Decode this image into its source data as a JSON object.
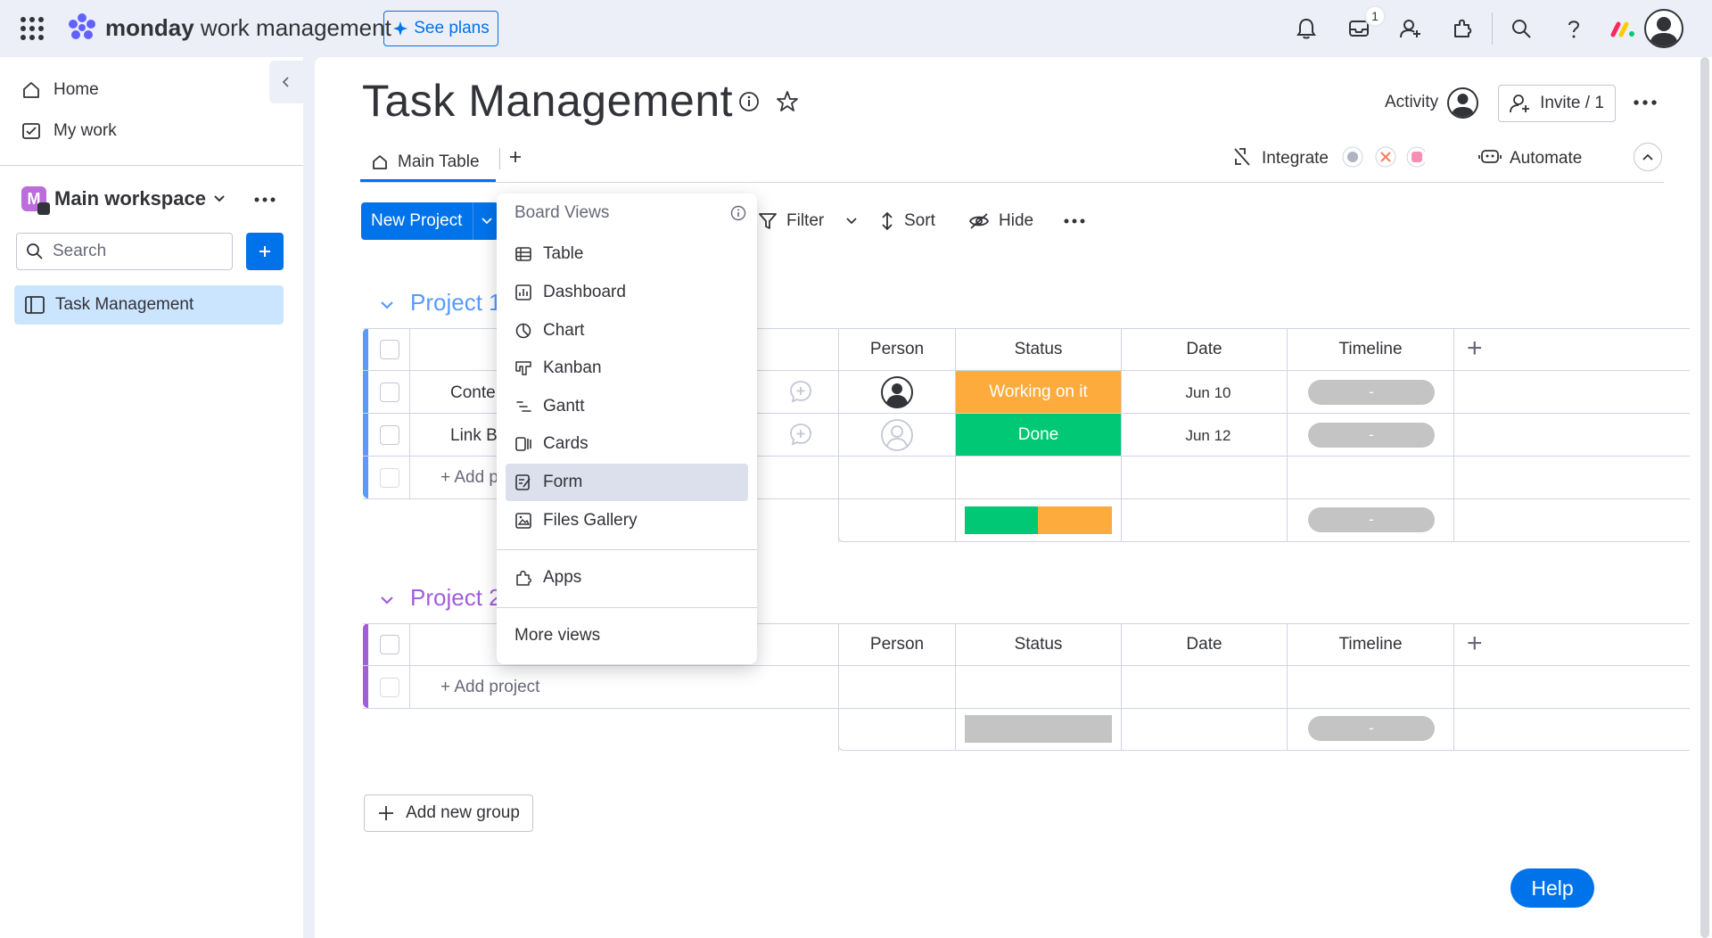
{
  "topbar": {
    "brand_bold": "monday",
    "brand_rest": " work management",
    "see_plans": "See plans",
    "inbox_badge": "1",
    "icons": [
      "apps-grid-icon",
      "bell-icon",
      "inbox-icon",
      "invite-members-icon",
      "marketplace-icon",
      "search-icon",
      "help-icon"
    ]
  },
  "sidebar": {
    "home": "Home",
    "my_work": "My work",
    "workspace_initial": "M",
    "workspace_name": "Main workspace",
    "search_placeholder": "Search",
    "board": "Task Management"
  },
  "board": {
    "title": "Task Management",
    "activity": "Activity",
    "invite": "Invite / 1",
    "tab_main": "Main Table",
    "integrate": "Integrate",
    "automate": "Automate",
    "new_project": "New Project",
    "filter": "Filter",
    "sort": "Sort",
    "hide": "Hide"
  },
  "columns": {
    "person": "Person",
    "status": "Status",
    "date": "Date",
    "timeline": "Timeline"
  },
  "groups": [
    {
      "title": "Project 1",
      "color": "#579bfc",
      "rows": [
        {
          "name": "Conte",
          "status": "Working on it",
          "status_color": "#fdab3d",
          "date": "Jun 10",
          "timeline": "-"
        },
        {
          "name": "Link B",
          "status": "Done",
          "status_color": "#00c875",
          "date": "Jun 12",
          "timeline": "-"
        }
      ],
      "add_row": "+ Add p",
      "summary_timeline": "-"
    },
    {
      "title": "Project 2",
      "color": "#a25ddc",
      "rows": [],
      "add_row": "+ Add project",
      "summary_timeline": "-"
    }
  ],
  "add_group": "Add new group",
  "help": "Help",
  "dropdown": {
    "title": "Board Views",
    "items": [
      {
        "label": "Table",
        "icon": "table-icon"
      },
      {
        "label": "Dashboard",
        "icon": "dashboard-icon"
      },
      {
        "label": "Chart",
        "icon": "chart-icon"
      },
      {
        "label": "Kanban",
        "icon": "kanban-icon"
      },
      {
        "label": "Gantt",
        "icon": "gantt-icon"
      },
      {
        "label": "Cards",
        "icon": "cards-icon"
      },
      {
        "label": "Form",
        "icon": "form-icon"
      },
      {
        "label": "Files Gallery",
        "icon": "files-gallery-icon"
      }
    ],
    "apps": "Apps",
    "more": "More views",
    "highlighted": "Form"
  },
  "colors": {
    "accent": "#0073ea",
    "working": "#fdab3d",
    "done": "#00c875",
    "selected": "#cce5ff"
  }
}
